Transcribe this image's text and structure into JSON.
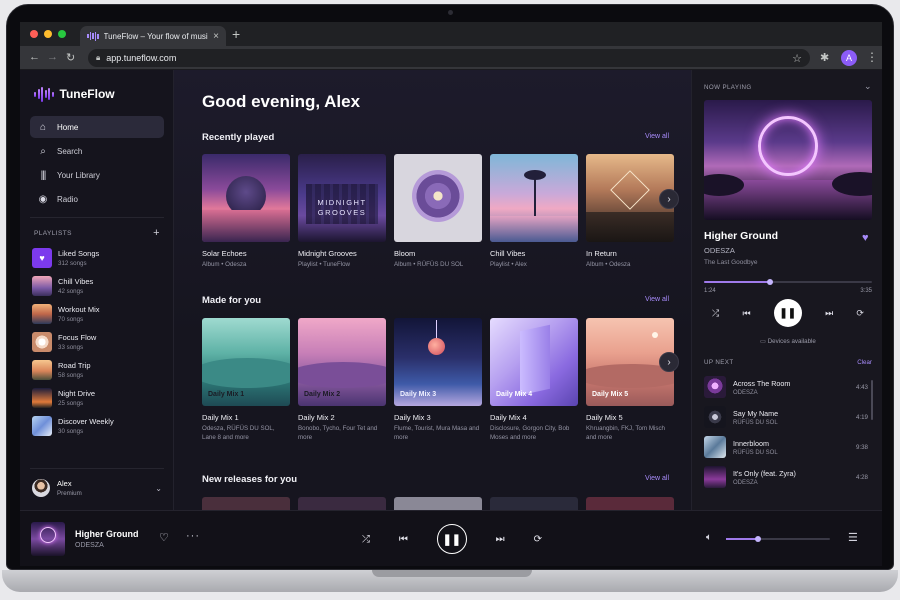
{
  "browser": {
    "tab_title": "TuneFlow – Your flow of music",
    "tab_close": "×",
    "new_tab": "+",
    "url": "app.tuneflow.com",
    "profile_initial": "A"
  },
  "sidebar": {
    "brand": "TuneFlow",
    "nav": [
      {
        "label": "Home",
        "icon": "home-icon",
        "active": true
      },
      {
        "label": "Search",
        "icon": "search-icon"
      },
      {
        "label": "Your Library",
        "icon": "library-icon"
      },
      {
        "label": "Radio",
        "icon": "radio-icon"
      }
    ],
    "playlists_header": "PLAYLISTS",
    "playlists": [
      {
        "name": "Liked Songs",
        "count": "312 songs",
        "color": "#7c3aed"
      },
      {
        "name": "Chill Vibes",
        "count": "42 songs"
      },
      {
        "name": "Workout Mix",
        "count": "70 songs"
      },
      {
        "name": "Focus Flow",
        "count": "33 songs"
      },
      {
        "name": "Road Trip",
        "count": "58 songs"
      },
      {
        "name": "Night Drive",
        "count": "25 songs"
      },
      {
        "name": "Discover Weekly",
        "count": "30 songs"
      }
    ],
    "user": {
      "name": "Alex",
      "plan": "Premium"
    }
  },
  "main": {
    "greeting": "Good evening, Alex",
    "recently_played": {
      "title": "Recently played",
      "view_all": "View all",
      "items": [
        {
          "title": "Solar Echoes",
          "sub": "Album • Odesza"
        },
        {
          "title": "Midnight Grooves",
          "sub": "Playlist • TuneFlow",
          "art_text": "MIDNIGHT GROOVES"
        },
        {
          "title": "Bloom",
          "sub": "Album • RÜFÜS DU SOL"
        },
        {
          "title": "Chill Vibes",
          "sub": "Playlist • Alex"
        },
        {
          "title": "In Return",
          "sub": "Album • Odesza"
        }
      ]
    },
    "made_for_you": {
      "title": "Made for you",
      "view_all": "View all",
      "items": [
        {
          "title": "Daily Mix 1",
          "label": "Daily Mix 1",
          "sub": "Odesza, RÜFÜS DU SOL, Lane 8 and more"
        },
        {
          "title": "Daily Mix 2",
          "label": "Daily Mix 2",
          "sub": "Bonobo, Tycho, Four Tet and more"
        },
        {
          "title": "Daily Mix 3",
          "label": "Daily Mix 3",
          "sub": "Flume, Tourist, Mura Masa and more"
        },
        {
          "title": "Daily Mix 4",
          "label": "Daily Mix 4",
          "sub": "Disclosure, Gorgon City, Bob Moses and more"
        },
        {
          "title": "Daily Mix 5",
          "label": "Daily Mix 5",
          "sub": "Khruangbin, FKJ, Tom Misch and more"
        }
      ]
    },
    "new_releases": {
      "title": "New releases for you",
      "view_all": "View all"
    }
  },
  "now_playing": {
    "header": "NOW PLAYING",
    "title": "Higher Ground",
    "artist": "ODESZA",
    "album": "The Last Goodbye",
    "elapsed": "1:24",
    "duration": "3:35",
    "progress": 0.39,
    "devices": "Devices available",
    "up_next_header": "UP NEXT",
    "clear": "Clear",
    "queue": [
      {
        "title": "Across The Room",
        "artist": "ODESZA",
        "duration": "4:43"
      },
      {
        "title": "Say My Name",
        "artist": "RÜFÜS DU SOL",
        "duration": "4:19"
      },
      {
        "title": "Innerbloom",
        "artist": "RÜFÜS DU SOL",
        "duration": "9:38"
      },
      {
        "title": "It's Only (feat. Zyra)",
        "artist": "ODESZA",
        "duration": "4:28"
      }
    ]
  },
  "player_bar": {
    "title": "Higher Ground",
    "artist": "ODESZA",
    "volume": 0.31
  },
  "colors": {
    "accent": "#a78bfa",
    "accent_strong": "#7c3aed"
  }
}
